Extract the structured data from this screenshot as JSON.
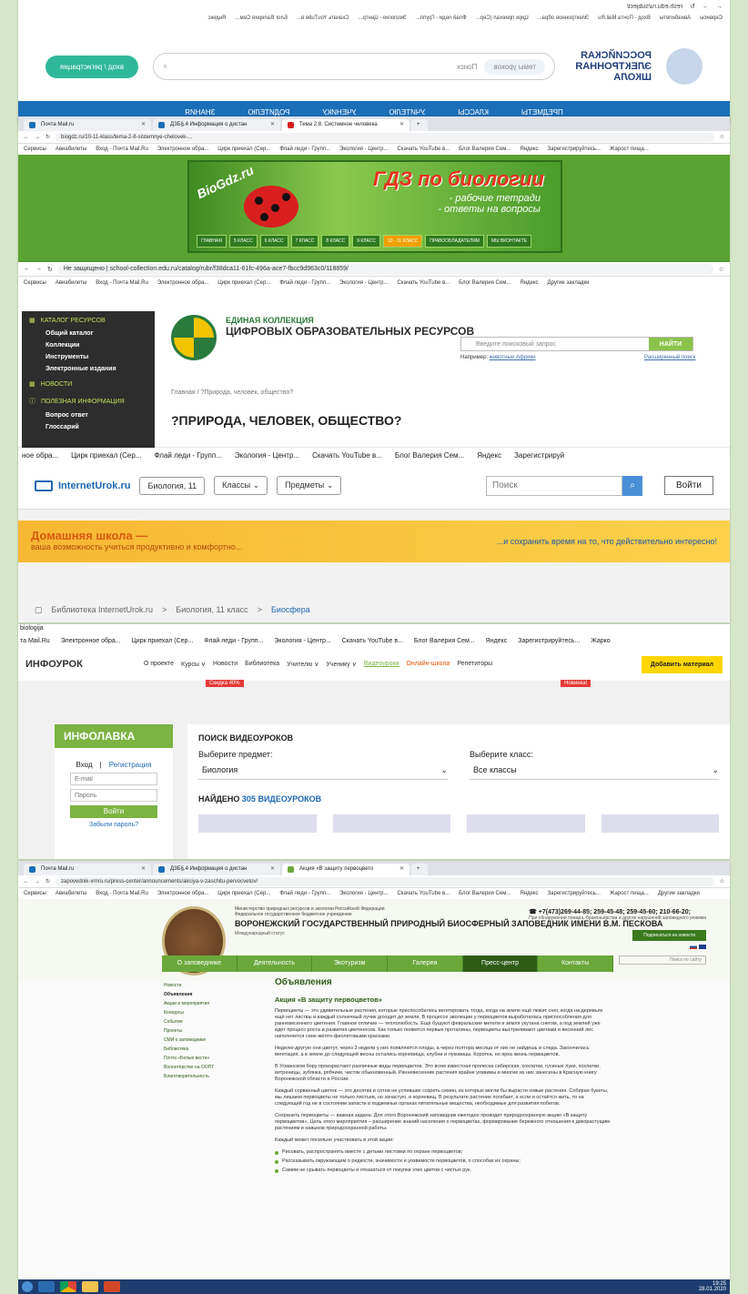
{
  "p1": {
    "url": "resh.edu.ru/subject/",
    "bookmarks": [
      "Сервисы",
      "Авиабилеты",
      "Вход - Почта Mail.Ru",
      "Электронное обра...",
      "Цирк приехал (Сер...",
      "Флай леди - Групп...",
      "Экология - Центр...",
      "Скачать YouTube в...",
      "Блог Валерия Сем...",
      "Яндекс"
    ],
    "logo": "РОССИЙСКАЯ ЭЛЕКТРОННАЯ ШКОЛА",
    "topic_placeholder": "темы уроков",
    "search_placeholder": "Поиск",
    "register": "вход / регистрация",
    "nav": [
      "ПРЕДМЕТЫ",
      "КЛАССЫ",
      "УЧИТЕЛЮ",
      "УЧЕНИКУ",
      "РОДИТЕЛЮ",
      "ЗНАНИЯ"
    ]
  },
  "p2": {
    "tabs": [
      "Почта Mail.ru",
      "ДЗБ§.4 Информация о дистан",
      "Тема 2.8. Системное человека"
    ],
    "url": "biogdz.ru/10-11-klass/tema-2-8-sistemnye-chelovek-...",
    "bookmarks": [
      "Сервисы",
      "Авиабилеты",
      "Вход - Почта Mail.Ru",
      "Электронное обра...",
      "Цирк приехал (Сер...",
      "Флай леди - Групп...",
      "Экология - Центр...",
      "Скачать YouTube в...",
      "Блог Валерия Сем...",
      "Яндекс",
      "Зарегистрируйтесь...",
      "Жарост пища..."
    ],
    "site": "BioGdz.ru",
    "title": "ГДЗ по биологии",
    "subtitle": "- рабочие тетради\n- ответы на вопросы",
    "menu": [
      "ГЛАВНАЯ",
      "5 КЛАСС",
      "6 КЛАСС",
      "7 КЛАСС",
      "8 КЛАСС",
      "9 КЛАСС",
      "10 - 11 КЛАСС",
      "ПРАВООБЛАДАТЕЛЯМ",
      "МЫ ВКОНТАКТЕ"
    ]
  },
  "p3": {
    "url": "Не защищено | school-collection.edu.ru/catalog/rubr/f38dca11-61fc-496a-ace7-fbcc9d963c0/118859/",
    "bookmarks": [
      "Сервисы",
      "Авиабилеты",
      "Вход - Почта Mail.Ru",
      "Электронное обра...",
      "Цирк приехал (Сер...",
      "Флай леди - Групп...",
      "Экология - Центр...",
      "Скачать YouTube в...",
      "Блог Валерия Сем...",
      "Яндекс",
      "Другие закладки"
    ],
    "side_catalog": "КАТАЛОГ РЕСУРСОВ",
    "side_items": [
      "Общий каталог",
      "Коллекции",
      "Инструменты",
      "Электронные издания"
    ],
    "side_news": "НОВОСТИ",
    "side_info": "ПОЛЕЗНАЯ ИНФОРМАЦИЯ",
    "side_info_items": [
      "Вопрос ответ",
      "Глоссарий"
    ],
    "title_small": "ЕДИНАЯ КОЛЛЕКЦИЯ",
    "title": "ЦИФРОВЫХ ОБРАЗОВАТЕЛЬНЫХ РЕСУРСОВ",
    "search_placeholder": "Введите поисковый запрос",
    "search_btn": "НАЙТИ",
    "example_label": "Например:",
    "example_link": "животные Африки",
    "advanced": "Расширенный поиск",
    "crumbs": "Главная / ?Природа, человек, общество?",
    "h1": "?ПРИРОДА, ЧЕЛОВЕК, ОБЩЕСТВО?"
  },
  "p4": {
    "bookmarks": [
      "ное обра...",
      "Цирк приехал (Сер...",
      "Флай леди - Групп...",
      "Экология - Центр...",
      "Скачать YouTube в...",
      "Блог Валерия Сем...",
      "Яндекс",
      "Зарегистрируй"
    ],
    "brand": "InternetUrok.ru",
    "course": "Биология, 11",
    "classes": "Классы",
    "subjects": "Предметы",
    "search_placeholder": "Поиск",
    "login": "Войти",
    "banner_title": "Домашняя школа —",
    "banner_sub": "ваша возможность учиться продуктивно и комфортно...",
    "banner_right": "...и сохранить время на то, что действительно интересно!",
    "crumbs": [
      "Библиотека InternetUrok.ru",
      ">",
      "Биология, 11 класс",
      ">",
      "Биосфера"
    ]
  },
  "p5": {
    "topline": "biologija",
    "bookmarks": [
      "та Mail.Ru",
      "Электронное обра...",
      "Цирк приехал (Сер...",
      "Флай леди - Групп...",
      "Экология - Центр...",
      "Скачать YouTube в...",
      "Блог Валерия Сем...",
      "Яндекс",
      "Зарегистрируйтесь...",
      "Жарко"
    ],
    "brand": "ИНФОУРОК",
    "nav": [
      "О проекте",
      "Курсы ∨",
      "Новости",
      "Библиотека",
      "Учителю ∨",
      "Ученику ∨",
      "Видеоуроки",
      "Онлайн-школа",
      "Репетиторы"
    ],
    "add": "Добавить материал",
    "discount": "Скидка 40%",
    "newbadge": "Новинка!",
    "lavka": "ИНФОЛАВКА",
    "login": "Вход",
    "register": "Регистрация",
    "email_ph": "E-mail",
    "pass_ph": "Пароль",
    "go": "Войти",
    "forgot": "Забыли пароль?",
    "search_title": "ПОИСК ВИДЕОУРОКОВ",
    "subject_label": "Выберите предмет:",
    "subject_value": "Биология",
    "class_label": "Выберите класс:",
    "class_value": "Все классы",
    "found_prefix": "НАЙДЕНО",
    "found_count": "305",
    "found_suffix": "ВИДЕОУРОКОВ"
  },
  "p6": {
    "tabs": [
      "Почта Mail.ru",
      "ДЗБ§.4 Информация о дистан",
      "Акция «В защиту первоцвето"
    ],
    "url": "zapovednik-vrnru.ru/press-center/announcements/akciya-v-zaschitu-pervocvetov/",
    "bookmarks": [
      "Сервисы",
      "Авиабилеты",
      "Вход - Почта Mail.Ru",
      "Электронное обра...",
      "Цирк приехал (Сер...",
      "Флай леди - Групп...",
      "Экология - Центр...",
      "Скачать YouTube в...",
      "Блог Валерия Сем...",
      "Яндекс",
      "Зарегистрируйтесь...",
      "Жарост пища...",
      "Другие закладки"
    ],
    "ministry": "Министерство природных ресурсов и экологии Российской Федерации",
    "fgbu": "Федеральное государственное бюджетное учреждение",
    "name": "ВОРОНЕЖСКИЙ ГОСУДАРСТВЕННЫЙ ПРИРОДНЫЙ БИОСФЕРНЫЙ ЗАПОВЕДНИК ИМЕНИ В.М. ПЕСКОВА",
    "status": "Международный статус",
    "phone": "+7(473)269-44-85; 259-45-48; 259-45-60; 210-66-20;",
    "phone_note": "При обнаружении пожара, браконьерства и других нарушений заповедного режима",
    "subscribe": "Подписаться на новости",
    "search_ph": "Поиск по сайту",
    "menu": [
      "О заповеднике",
      "Деятельность",
      "Экотуризм",
      "Галерея",
      "Пресс-центр",
      "Контакты"
    ],
    "lnav": [
      "Новости",
      "Объявления",
      "Акции и мероприятия",
      "Конкурсы",
      "События",
      "Проекты",
      "СМИ о заповеднике",
      "Библиотека",
      "Почта «Белые вести»",
      "Волонтёрство на ООПТ",
      "Благотворительность"
    ],
    "h2": "Объявления",
    "h3": "Акция «В защиту первоцветов»",
    "paras": [
      "Первоцветы — это удивительные растения, которые приспособились вегетировать тогда, когда на земле ещё лежит снег, когда на деревьях ещё нет листвы и каждый солнечный лучик доходит до земли. В процессе эволюции у первоцветов выработалась приспособления для ранневесеннего цветения. Главное отличие — теплолюбость. Ещё бушуют февральские метели и земля укутана снегом, а под землей уже идёт процесс роста и развития цветоносов. Как только появятся первые проталины, первоцветы выстреливают цветами и весенний лес наполняется сине-жёлто-фиолетовыми красками.",
      "Неделю-другую они цветут, через 3 недели у них появляются плоды, а через полтора месяца от них не найдешь и следа. Закончилась вегетация, а в земле до следующей весны остались корневища, клубни и луковицы. Коротка, но ярка жизнь первоцветов.",
      "В Усманском бору произрастают различные виды первоцветов. Это всем известная пролеска сибирская, хохлатки, гусиные луки, хохлатки, ветреницы, зубянка, рябчики, чистяк обыкновенный. Ранневесенние растения крайне уязвимы и многие из них занесены в Красную книгу Воронежской области и России.",
      "Каждый сорванный цветок — это десятки и сотни не успевших созреть семян, из которых могли бы вырасти новые растения. Собирая букеты, мы лишаем первоцветы не только листьев, но зачастую, и корневищ. В результате растение погибает, а если и остаётся жить, то на следующий год не в состоянии запасти в подземных органах питательные вещества, необходимые для развития побегов.",
      "Сохранить первоцветы — важная задача. Для этого Воронежский заповедник ежегодно проводит природоохранную акцию «В защиту первоцветов». Цель этого мероприятия – расширение знаний населения о первоцветах, формирование бережного отношения к дикорастущим растениям и навыков природоохранной работы.",
      "Каждый может посильно участвовать в этой акции:"
    ],
    "bullets": [
      "Рисовать, распространять вместе с детьми листовки по охране первоцветов;",
      "Рассказывать окружающим о редкости, значимости и уязвимости первоцветов, о способах их охраны;",
      "Самим не срывать первоцветы и отказаться от покупки этих цветов с чистых рук."
    ]
  },
  "taskbar": {
    "time": "19:25",
    "date": "28.01.2020"
  },
  "colors": {
    "bg": "#d6e7c9",
    "res_blue": "#1a6fb8",
    "green": "#6aa83b"
  }
}
